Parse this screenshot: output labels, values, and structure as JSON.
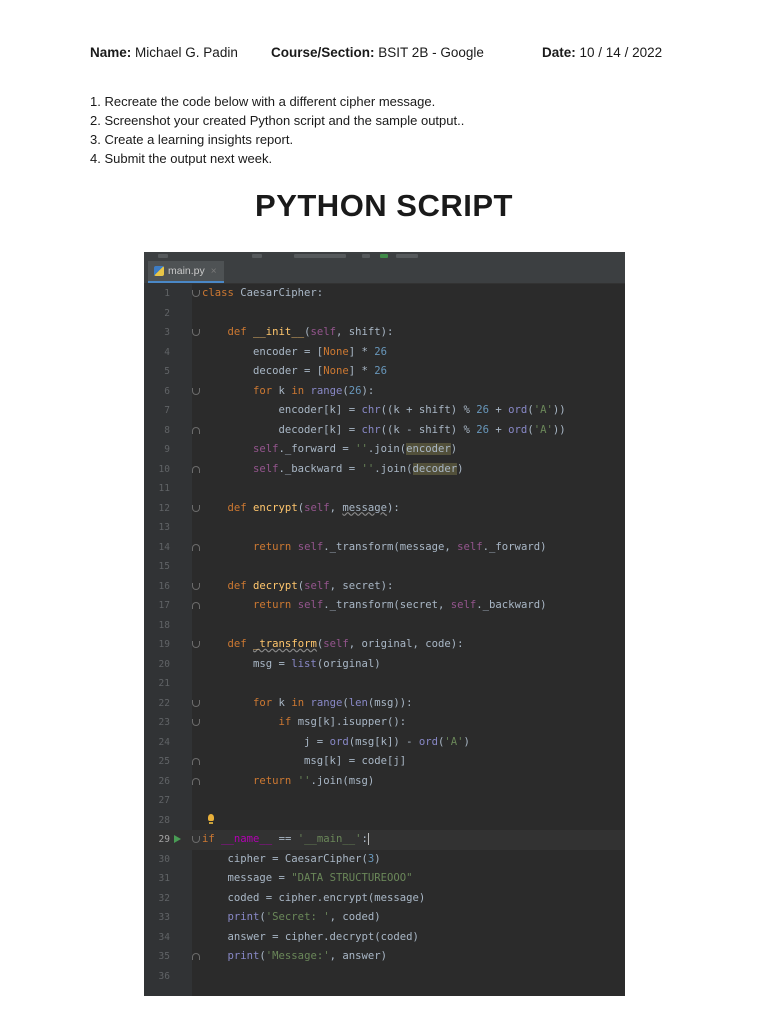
{
  "header": {
    "name_label": "Name:",
    "name_value": "Michael G. Padin",
    "course_label": "Course/Section:",
    "course_value": "BSIT 2B - Google",
    "date_label": "Date:",
    "date_value": "10 / 14 / 2022"
  },
  "instructions": [
    "1. Recreate the code below with a different cipher message.",
    "2. Screenshot your created Python script and the sample output..",
    "3. Create a learning insights report.",
    "4. Submit the output next week."
  ],
  "heading": "PYTHON SCRIPT",
  "ide": {
    "tab_label": "main.py",
    "current_line": 29,
    "code_lines": [
      "class CaesarCipher:",
      "",
      "    def __init__(self, shift):",
      "        encoder = [None] * 26",
      "        decoder = [None] * 26",
      "        for k in range(26):",
      "            encoder[k] = chr((k + shift) % 26 + ord('A'))",
      "            decoder[k] = chr((k - shift) % 26 + ord('A'))",
      "        self._forward = ''.join(encoder)",
      "        self._backward = ''.join(decoder)",
      "",
      "    def encrypt(self, message):",
      "",
      "        return self._transform(message, self._forward)",
      "",
      "    def decrypt(self, secret):",
      "        return self._transform(secret, self._backward)",
      "",
      "    def _transform(self, original, code):",
      "        msg = list(original)",
      "",
      "        for k in range(len(msg)):",
      "            if msg[k].isupper():",
      "                j = ord(msg[k]) - ord('A')",
      "                msg[k] = code[j]",
      "        return ''.join(msg)",
      "",
      "",
      "if __name__ == '__main__':",
      "    cipher = CaesarCipher(3)",
      "    message = \"DATA STRUCTUREOOO\"",
      "    coded = cipher.encrypt(message)",
      "    print('Secret: ', coded)",
      "    answer = cipher.decrypt(coded)",
      "    print('Message:', answer)",
      ""
    ]
  }
}
